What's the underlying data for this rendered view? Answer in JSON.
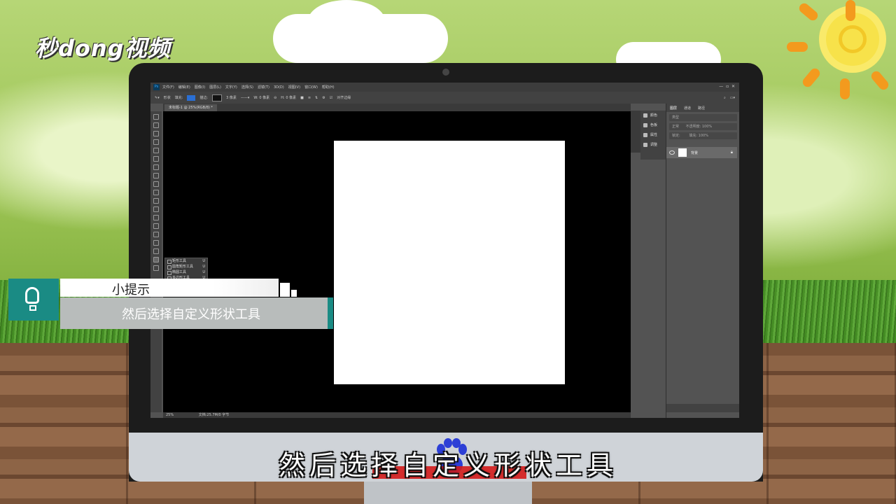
{
  "logo": {
    "text": "秒dong视频"
  },
  "photoshop": {
    "menu": [
      "文件(F)",
      "编辑(E)",
      "图像(I)",
      "图层(L)",
      "文字(Y)",
      "选择(S)",
      "滤镜(T)",
      "3D(D)",
      "视图(V)",
      "窗口(W)",
      "帮助(H)"
    ],
    "options": {
      "mode": "形状",
      "fill_label": "填充:",
      "stroke_label": "描边:",
      "stroke_size": "3 像素",
      "w_label": "W: 0 像素",
      "h_label": "H: 0 像素",
      "align_label": "对齐边缘"
    },
    "doc_tab": "未标题-1 @ 25%(RGB/8) *",
    "status": {
      "zoom": "25%",
      "doc": "文档:25.7M/0 字节"
    },
    "flyout": [
      {
        "label": "矩形工具",
        "key": "U"
      },
      {
        "label": "圆角矩形工具",
        "key": "U"
      },
      {
        "label": "椭圆工具",
        "key": "U"
      },
      {
        "label": "多边形工具",
        "key": "U"
      }
    ],
    "dock": [
      "颜色",
      "色板",
      "属性",
      "调整"
    ],
    "layers_tabs": [
      "图层",
      "通道",
      "路径"
    ],
    "layers_kind": "类型",
    "blend_mode": "正常",
    "opacity": "不透明度: 100%",
    "lock_label": "锁定:",
    "fill": "填充: 100%",
    "layer": {
      "name": "背景"
    }
  },
  "hint": {
    "title": "小提示",
    "body": "然后选择自定义形状工具"
  },
  "subtitle": "然后选择自定义形状工具"
}
